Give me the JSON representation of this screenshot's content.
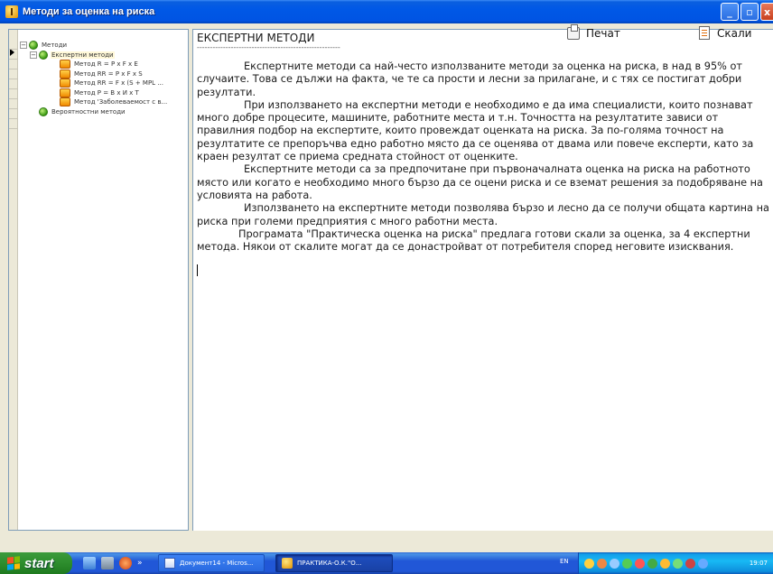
{
  "window": {
    "title": "Методи за оценка на риска",
    "controls": {
      "minimize": "_",
      "maximize": "▫",
      "close": "x"
    }
  },
  "tree": {
    "root": {
      "label": "Методи"
    },
    "expert_group": {
      "label": "Експертни методи"
    },
    "items": [
      {
        "label": "Метод R = P x F x E"
      },
      {
        "label": "Метод RR = P x F x S"
      },
      {
        "label": "Метод RR = F x (S + MPL ..."
      },
      {
        "label": "Метод P = B x И x T"
      },
      {
        "label": "Метод 'Заболеваемост с в..."
      }
    ],
    "probability_group": {
      "label": "Вероятностни методи"
    },
    "expanders": {
      "root": "−",
      "expert": "−"
    }
  },
  "content": {
    "title": "ЕКСПЕРТНИ МЕТОДИ",
    "rule": "-------------------------------------------------------",
    "paragraphs": [
      "Експертните методи са най-често използваните методи за оценка на риска, в над в 95% от случаите. Това се дължи на факта, че те са прости и лесни за прилагане, и с тях се постигат добри резултати.",
      "При използването на експертни методи е необходимо е да има специалисти, които познават много добре процесите, машините, работните места и т.н. Точността на резултатите зависи от правилния подбор на експертите, които провеждат оценката на риска. За по-голяма точност на резултатите се препоръчва едно работно място да се оценява от двама или повече експерти, като за краен резултат се приема средната стойност от оценките.",
      "Експертните методи са за предпочитане при първоначалната оценка на риска на работното място или когато е необходимо много бързо да се оцени риска и се вземат решения за подобряване на условията на работа.",
      "Използването на експертните методи позволява бързо и лесно да се получи общата картина на риска при големи предприятия с много работни места.",
      "Програмата \"Практическа оценка на риска\" предлага готови  скали за оценка, за 4 експертни метода. Някои от скалите могат да се донастройват от потребителя според неговите изисквания."
    ]
  },
  "actions": {
    "print_label": "Печат",
    "scales_label": "Скали"
  },
  "taskbar": {
    "start_label": "start",
    "quick_chevron": "»",
    "tasks": [
      {
        "label": "Документ14 - Micros..."
      },
      {
        "label": "ПРАКТИКА-О.К.\"О..."
      }
    ],
    "language": "EN",
    "clock": "19:07"
  }
}
